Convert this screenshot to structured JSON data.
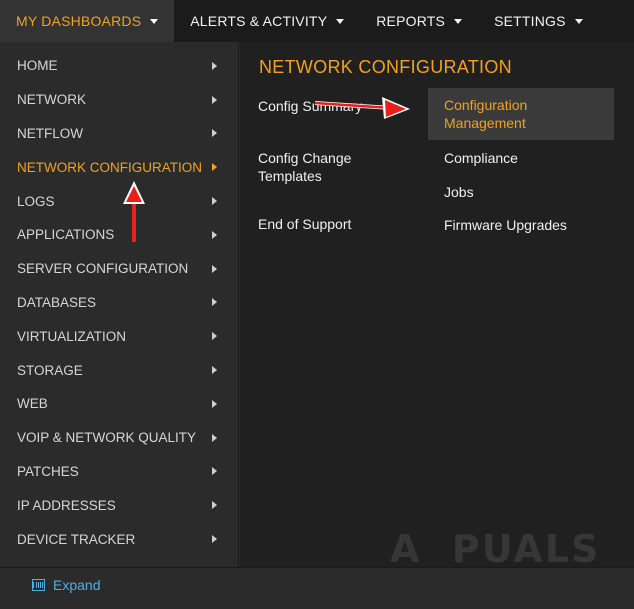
{
  "topnav": {
    "tabs": [
      {
        "label": "MY DASHBOARDS"
      },
      {
        "label": "ALERTS & ACTIVITY"
      },
      {
        "label": "REPORTS"
      },
      {
        "label": "SETTINGS"
      }
    ]
  },
  "menu": {
    "items": [
      {
        "label": "HOME"
      },
      {
        "label": "NETWORK"
      },
      {
        "label": "NETFLOW"
      },
      {
        "label": "NETWORK CONFIGURATION"
      },
      {
        "label": "LOGS"
      },
      {
        "label": "APPLICATIONS"
      },
      {
        "label": "SERVER CONFIGURATION"
      },
      {
        "label": "DATABASES"
      },
      {
        "label": "VIRTUALIZATION"
      },
      {
        "label": "STORAGE"
      },
      {
        "label": "WEB"
      },
      {
        "label": "VOIP & NETWORK QUALITY"
      },
      {
        "label": "PATCHES"
      },
      {
        "label": "IP ADDRESSES"
      },
      {
        "label": "DEVICE TRACKER"
      }
    ]
  },
  "flyout": {
    "title": "NETWORK CONFIGURATION",
    "col1": [
      {
        "label": "Config Summary"
      },
      {
        "label": "Config Change Templates"
      },
      {
        "label": "End of Support"
      }
    ],
    "col2": [
      {
        "label": "Configuration Management"
      },
      {
        "label": "Compliance"
      },
      {
        "label": "Jobs"
      },
      {
        "label": "Firmware Upgrades"
      }
    ]
  },
  "bottom": {
    "expand_label": "Expand"
  },
  "watermark": "APPUALS",
  "colors": {
    "accent": "#f2a21c",
    "link": "#4fb0e6",
    "annotation_arrow": "#e8201b"
  }
}
